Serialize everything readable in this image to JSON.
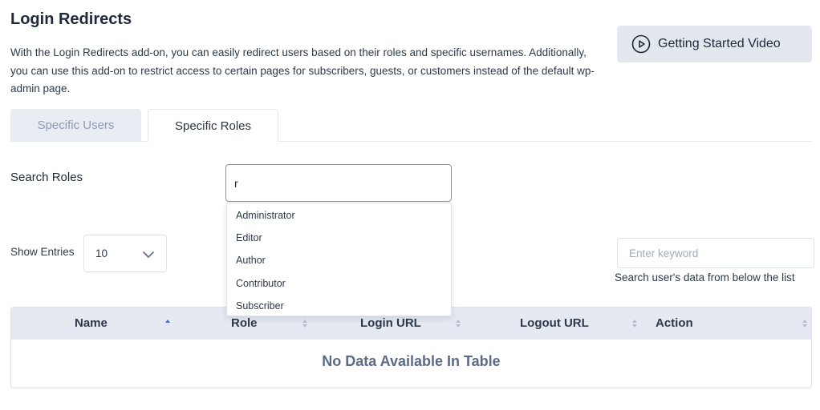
{
  "header": {
    "title": "Login Redirects",
    "description": "With the Login Redirects add-on, you can easily redirect users based on their roles and specific usernames. Additionally, you can use this add-on to restrict access to certain pages for subscribers, guests, or customers instead of the default wp-admin page.",
    "video_button": "Getting Started Video",
    "video_icon": "play-circle-icon"
  },
  "tabs": [
    {
      "label": "Specific Users",
      "active": false
    },
    {
      "label": "Specific Roles",
      "active": true
    }
  ],
  "search_roles": {
    "label": "Search Roles",
    "value": "r",
    "suggestions": [
      "Administrator",
      "Editor",
      "Author",
      "Contributor",
      "Subscriber"
    ]
  },
  "entries": {
    "label": "Show Entries",
    "selected": "10",
    "icon": "chevron-down-icon"
  },
  "keyword_search": {
    "placeholder": "Enter keyword",
    "hint": "Search user's data from below the list"
  },
  "table": {
    "columns": [
      "Name",
      "Role",
      "Login URL",
      "Logout URL",
      "Action"
    ],
    "empty_message": "No Data Available In Table"
  },
  "colors": {
    "accent": "#1e2a3b",
    "header_bg": "#e5e9f1",
    "muted": "#5b6a87"
  }
}
